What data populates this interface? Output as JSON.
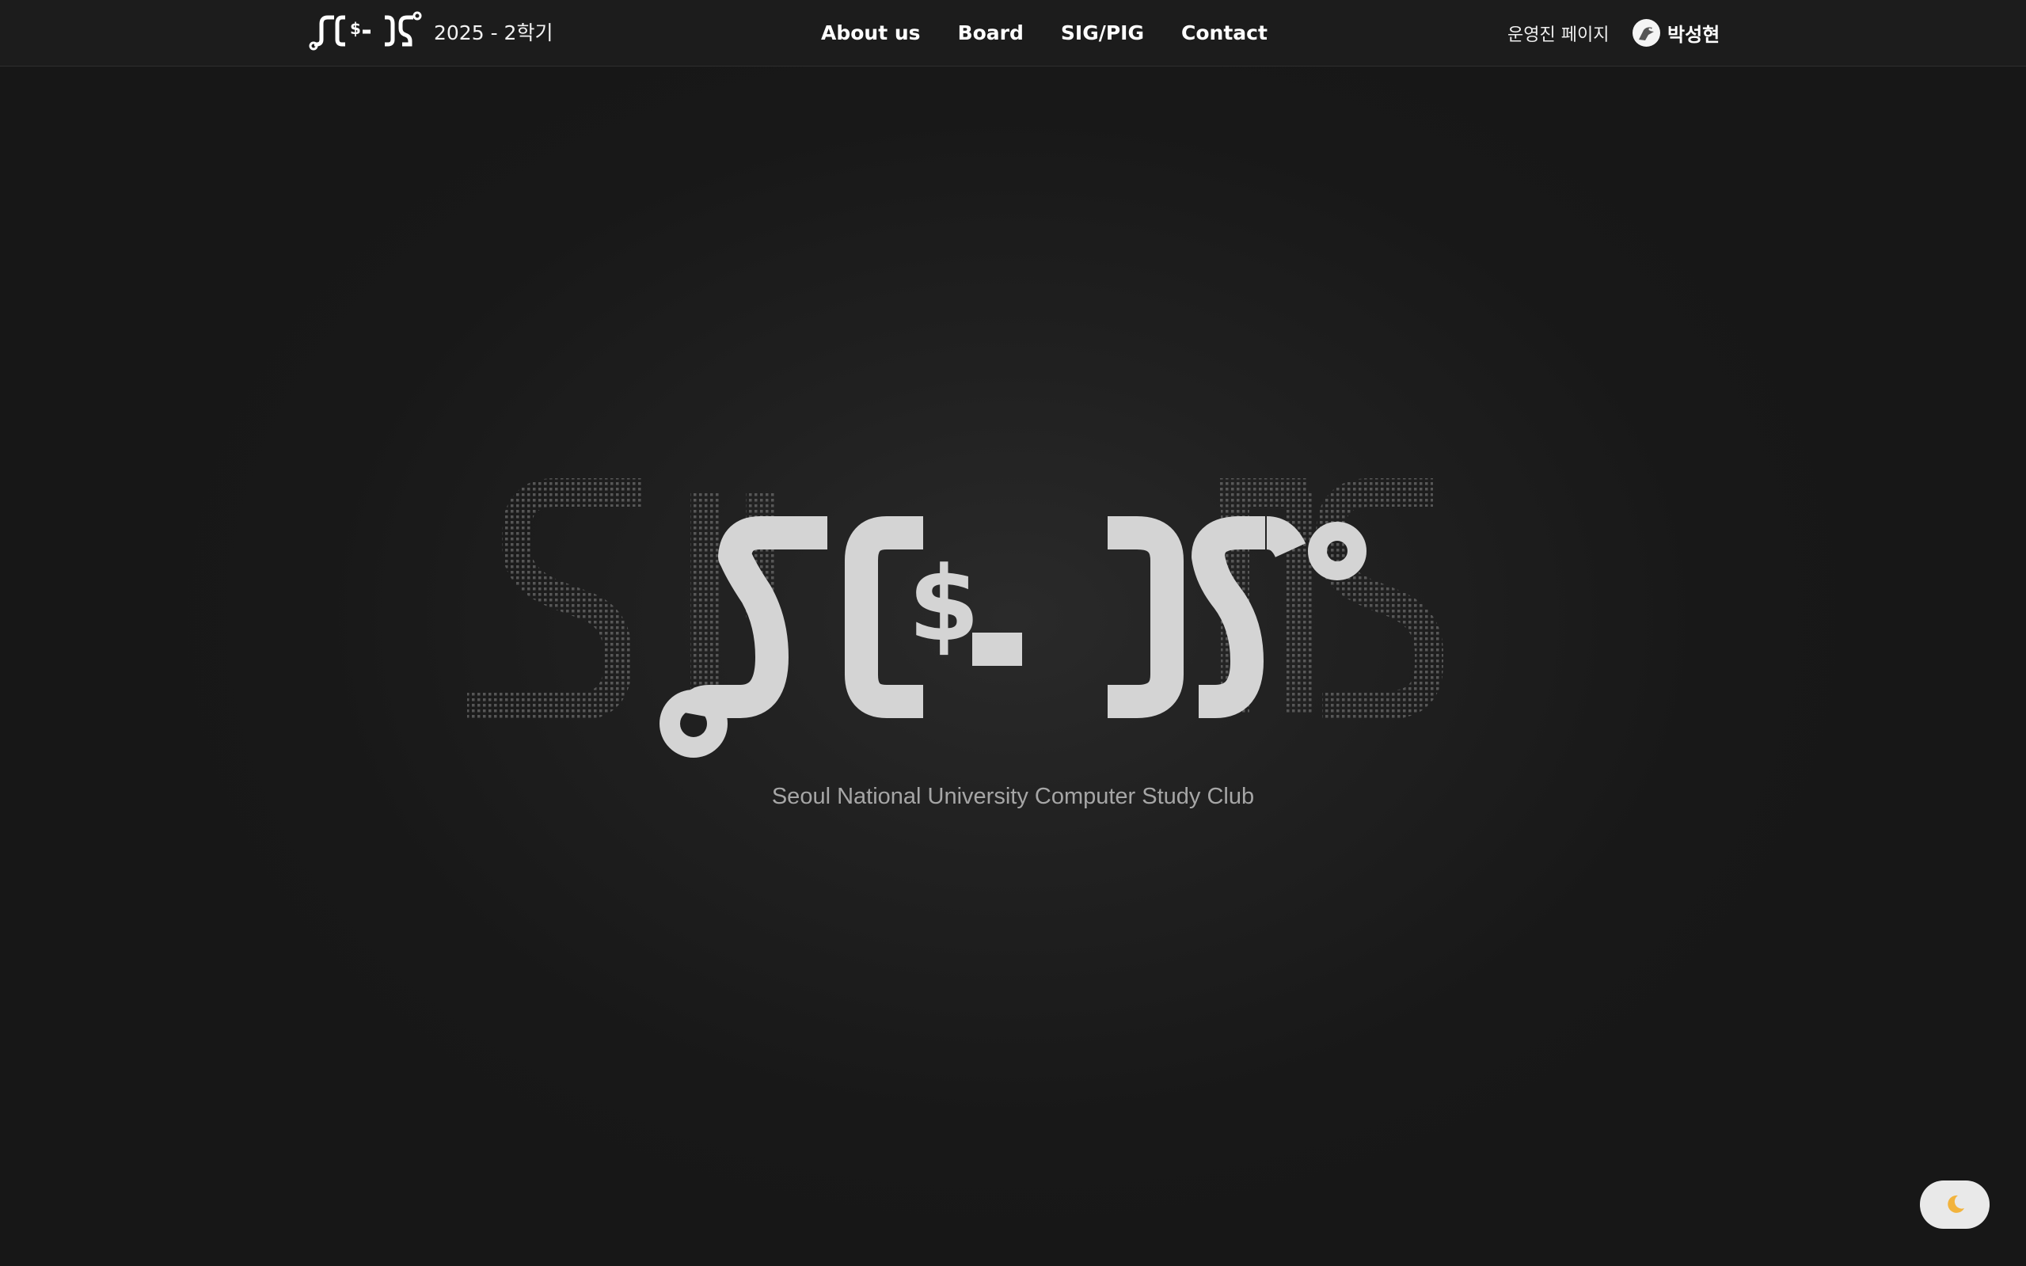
{
  "header": {
    "logo_icon": "sigpig-logo",
    "semester": "2025 - 2학기",
    "nav": [
      {
        "label": "About us"
      },
      {
        "label": "Board"
      },
      {
        "label": "SIG/PIG"
      },
      {
        "label": "Contact"
      }
    ],
    "admin_link": "운영진 페이지",
    "user": {
      "avatar_icon": "avatar-icon",
      "name": "박성현"
    }
  },
  "hero": {
    "logo_icon": "sigpig-large-logo",
    "subtitle": "Seoul National University Computer Study Club"
  },
  "theme_toggle": {
    "icon": "moon-icon"
  },
  "colors": {
    "background": "#171717",
    "header_bg": "#1c1c1c",
    "logo_fill": "#d4d4d4",
    "subtitle": "#a6a6a6",
    "moon": "#f2b33d"
  }
}
